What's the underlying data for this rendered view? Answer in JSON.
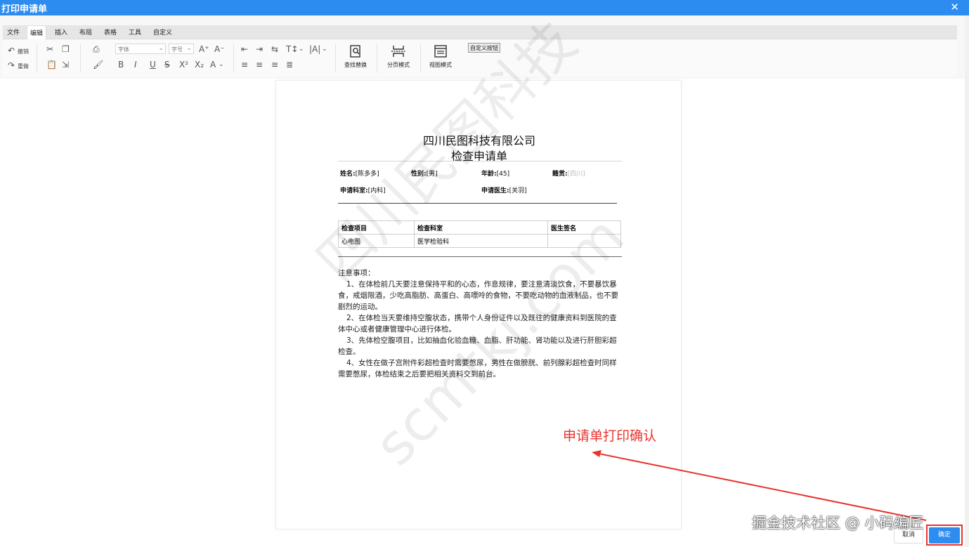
{
  "window": {
    "title": "打印申请单",
    "close_glyph": "✕"
  },
  "ribbon": {
    "tabs": [
      "文件",
      "编辑",
      "插入",
      "布局",
      "表格",
      "工具",
      "自定义"
    ],
    "active_tab": "编辑",
    "undo_label": "撤销",
    "redo_label": "重做",
    "font_family_placeholder": "字体",
    "font_size_placeholder": "字号",
    "bold": "B",
    "italic": "I",
    "underline": "U",
    "strike": "S",
    "superscript": "X²",
    "subscript": "X₂",
    "font_color": "A",
    "grow_font": "A⁺",
    "shrink_font": "A⁻",
    "find_replace_label": "查找替换",
    "page_mode_label": "分页模式",
    "view_mode_label": "视图模式",
    "custom_button_label": "自定义按钮"
  },
  "document": {
    "company": "四川民图科技有限公司",
    "title": "检查申请单",
    "fields": {
      "name_label": "姓名:",
      "name_value": "[陈多多]",
      "gender_label": "性别:",
      "gender_value": "[男]",
      "age_label": "年龄:",
      "age_value": "[45]",
      "native_label": "籍贯:",
      "native_value": "[四川]",
      "dept_label": "申请科室:",
      "dept_value": "[内科]",
      "doctor_label": "申请医生:",
      "doctor_value": "[关羽]"
    },
    "table": {
      "headers": [
        "检查项目",
        "检查科室",
        "医生签名"
      ],
      "rows": [
        [
          "心电图",
          "医学检验科",
          ""
        ]
      ]
    },
    "notes_title": "注意事项：",
    "notes": [
      "1、在体检前几天要注意保持平和的心态，作息规律，要注意清淡饮食，不要暴饮暴食，戒烟限酒，少吃高脂肪、高蛋白、高嘌呤的食物，不要吃动物的血液制品，也不要剧烈的运动。",
      "2、在体检当天要维持空腹状态，携带个人身份证件以及既往的健康资料到医院的查体中心或者健康管理中心进行体检。",
      "3、先体检空腹项目，比如抽血化验血糖、血脂、肝功能、肾功能以及进行肝胆彩超检查。",
      "4、女性在做子宫附件彩超检查时需要憋尿，男性在做膀胱、前列腺彩超检查时同样需要憋尿，体检结束之后要把相关资料交到前台。"
    ]
  },
  "watermark": {
    "line1": "四川民图科技",
    "line2": "scmtkj.com"
  },
  "annotation": "申请单打印确认",
  "footer_watermark": "掘金技术社区 @ 小码编匠",
  "actions": {
    "cancel_label": "取消",
    "ok_label": "确定"
  },
  "colors": {
    "accent": "#2d8cf0",
    "annotation_red": "#e8342f"
  }
}
